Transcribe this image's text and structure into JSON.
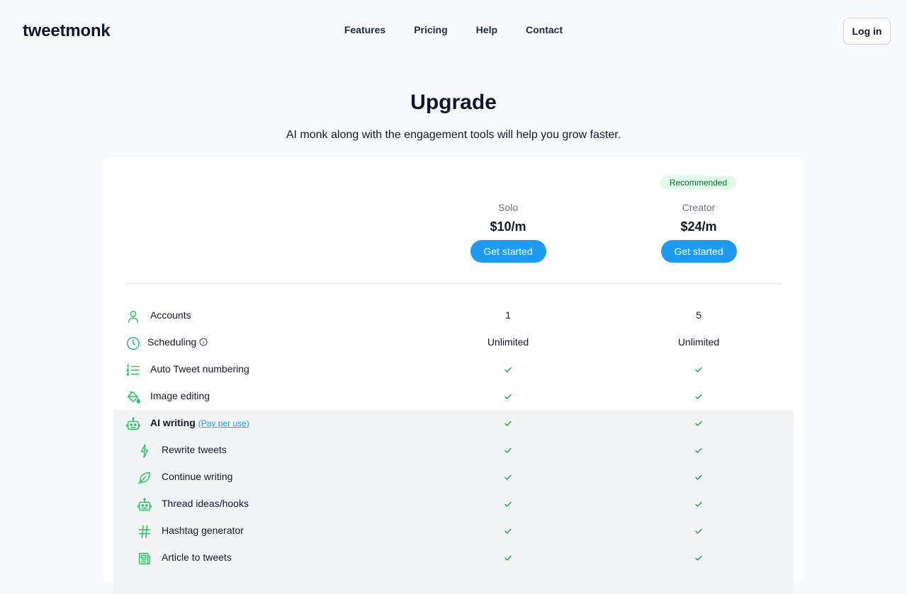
{
  "header": {
    "logo": "tweetmonk",
    "nav": [
      "Features",
      "Pricing",
      "Help",
      "Contact"
    ],
    "login_label": "Log in"
  },
  "hero": {
    "title": "Upgrade",
    "subtitle": "AI monk along with the engagement tools will help you grow faster."
  },
  "plans": [
    {
      "name": "Solo",
      "price": "$10/m",
      "cta": "Get started",
      "badge": ""
    },
    {
      "name": "Creator",
      "price": "$24/m",
      "cta": "Get started",
      "badge": "Recommended"
    }
  ],
  "features": [
    {
      "label": "Accounts",
      "icon": "user-icon",
      "solo": "1",
      "creator": "5"
    },
    {
      "label": "Scheduling",
      "icon": "clock-icon",
      "solo": "Unlimited",
      "creator": "Unlimited"
    },
    {
      "label": "Auto Tweet numbering",
      "icon": "numbered-list-icon",
      "solo": "check",
      "creator": "check"
    },
    {
      "label": "Image editing",
      "icon": "paint-bucket-icon",
      "solo": "check",
      "creator": "check"
    },
    {
      "label": "AI writing",
      "note": "(Pay per use)",
      "icon": "robot-icon",
      "solo": "check",
      "creator": "check"
    },
    {
      "label": "Rewrite tweets",
      "icon": "lightning-icon",
      "solo": "check",
      "creator": "check"
    },
    {
      "label": "Continue writing",
      "icon": "feather-icon",
      "solo": "check",
      "creator": "check"
    },
    {
      "label": "Thread ideas/hooks",
      "icon": "robot-icon",
      "solo": "check",
      "creator": "check"
    },
    {
      "label": "Hashtag generator",
      "icon": "hashtag-icon",
      "solo": "check",
      "creator": "check"
    },
    {
      "label": "Article to tweets",
      "icon": "newspaper-icon",
      "solo": "check",
      "creator": "check"
    }
  ],
  "colors": {
    "accent": "#1d9bf0",
    "icon_green": "#22c55e",
    "check_green": "#16a34a",
    "badge_bg": "#dcfce7"
  }
}
